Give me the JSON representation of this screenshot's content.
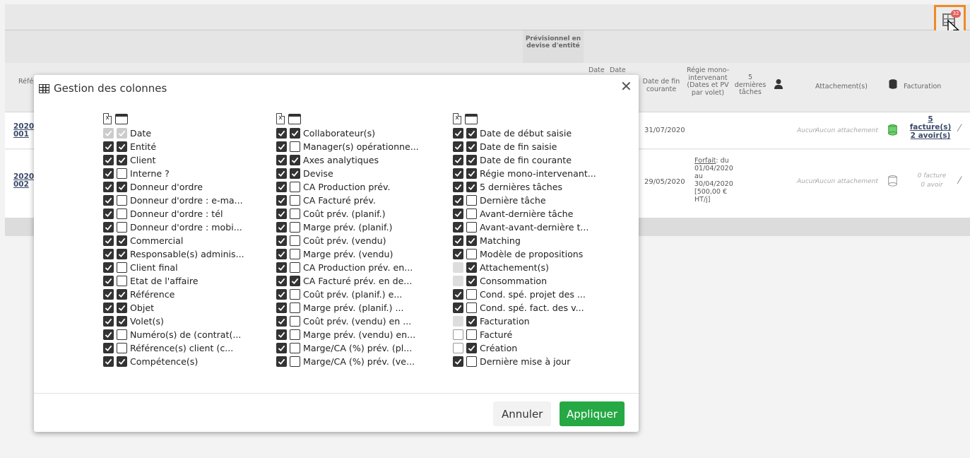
{
  "colors": {
    "accent": "#f08a24",
    "apply": "#26a844",
    "badge": "#e0605a",
    "db_active": "#6fcf6f"
  },
  "toolbar": {
    "columns_badge": "32"
  },
  "table": {
    "group_header": "Prévisionnel en devise d'entité",
    "headers": {
      "ref": "Réfé",
      "date1": "Date",
      "date2": "Date",
      "date_fin": "Date de fin courante",
      "regie": "Régie mono-intervenant (Dates et PV par volet)",
      "dernieres": "5 dernières tâches",
      "attach": "Attachement(s)",
      "facturation": "Facturation"
    },
    "rows": [
      {
        "ref": "2020 001",
        "date_fin": "31/07/2020",
        "regie": "",
        "dernieres": "Aucun",
        "attach": "Aucun attachement",
        "fact_line1": "5",
        "fact_line2": "facture(s)",
        "fact_line3": "2 avoir(s)"
      },
      {
        "ref": "2020 002",
        "date_fin": "29/05/2020",
        "regie_link": "Forfait",
        "regie": ": du 01/04/2020 au 30/04/2020 [500,00 € HT/j]",
        "dernieres": "Aucun",
        "attach": "Aucun attachement",
        "fact_line1": "0 facture",
        "fact_line2": "0 avoir"
      }
    ]
  },
  "modal": {
    "title": "Gestion des colonnes",
    "cancel_label": "Annuler",
    "apply_label": "Appliquer",
    "columns": [
      [
        {
          "label": "Date",
          "excel": "dis",
          "visible": "dis"
        },
        {
          "label": "Entité",
          "excel": "on",
          "visible": "on"
        },
        {
          "label": "Client",
          "excel": "on",
          "visible": "on"
        },
        {
          "label": "Interne ?",
          "excel": "on",
          "visible": "off"
        },
        {
          "label": "Donneur d'ordre",
          "excel": "on",
          "visible": "on"
        },
        {
          "label": "Donneur d'ordre : e-ma...",
          "excel": "on",
          "visible": "off"
        },
        {
          "label": "Donneur d'ordre : tél",
          "excel": "on",
          "visible": "off"
        },
        {
          "label": "Donneur d'ordre : mobi...",
          "excel": "on",
          "visible": "off"
        },
        {
          "label": "Commercial",
          "excel": "on",
          "visible": "on"
        },
        {
          "label": "Responsable(s) adminis...",
          "excel": "on",
          "visible": "on"
        },
        {
          "label": "Client final",
          "excel": "on",
          "visible": "off"
        },
        {
          "label": "Etat de l'affaire",
          "excel": "on",
          "visible": "off"
        },
        {
          "label": "Référence",
          "excel": "on",
          "visible": "on"
        },
        {
          "label": "Objet",
          "excel": "on",
          "visible": "on"
        },
        {
          "label": "Volet(s)",
          "excel": "on",
          "visible": "on"
        },
        {
          "label": "Numéro(s) de (contrat(...",
          "excel": "on",
          "visible": "off"
        },
        {
          "label": "Référence(s) client (c...",
          "excel": "on",
          "visible": "off"
        },
        {
          "label": "Compétence(s)",
          "excel": "on",
          "visible": "on"
        }
      ],
      [
        {
          "label": "Collaborateur(s)",
          "excel": "on",
          "visible": "on"
        },
        {
          "label": "Manager(s) opérationne...",
          "excel": "on",
          "visible": "off"
        },
        {
          "label": "Axes analytiques",
          "excel": "on",
          "visible": "on"
        },
        {
          "label": "Devise",
          "excel": "on",
          "visible": "on"
        },
        {
          "label": "CA Production prév.",
          "excel": "on",
          "visible": "off"
        },
        {
          "label": "CA Facturé prév.",
          "excel": "on",
          "visible": "off"
        },
        {
          "label": "Coût prév. (planif.)",
          "excel": "on",
          "visible": "off"
        },
        {
          "label": "Marge prév. (planif.)",
          "excel": "on",
          "visible": "off"
        },
        {
          "label": "Coût prév. (vendu)",
          "excel": "on",
          "visible": "off"
        },
        {
          "label": "Marge prév. (vendu)",
          "excel": "on",
          "visible": "off"
        },
        {
          "label": "CA Production prév. en...",
          "excel": "on",
          "visible": "off"
        },
        {
          "label": "CA Facturé prév. en de...",
          "excel": "on",
          "visible": "on"
        },
        {
          "label": "Coût prév. (planif.) e...",
          "excel": "on",
          "visible": "off"
        },
        {
          "label": "Marge prév. (planif.) ...",
          "excel": "on",
          "visible": "off"
        },
        {
          "label": "Coût prév. (vendu) en ...",
          "excel": "on",
          "visible": "off"
        },
        {
          "label": "Marge prév. (vendu) en...",
          "excel": "on",
          "visible": "off"
        },
        {
          "label": "Marge/CA (%) prév. (pl...",
          "excel": "on",
          "visible": "off"
        },
        {
          "label": "Marge/CA (%) prév. (ve...",
          "excel": "on",
          "visible": "off"
        }
      ],
      [
        {
          "label": "Date de début saisie",
          "excel": "on",
          "visible": "on"
        },
        {
          "label": "Date de fin saisie",
          "excel": "on",
          "visible": "on"
        },
        {
          "label": "Date de fin courante",
          "excel": "on",
          "visible": "on"
        },
        {
          "label": "Régie mono-intervenant...",
          "excel": "on",
          "visible": "on"
        },
        {
          "label": "5 dernières tâches",
          "excel": "on",
          "visible": "on"
        },
        {
          "label": "Dernière tâche",
          "excel": "on",
          "visible": "off"
        },
        {
          "label": "Avant-dernière tâche",
          "excel": "on",
          "visible": "off"
        },
        {
          "label": "Avant-avant-dernière t...",
          "excel": "on",
          "visible": "off"
        },
        {
          "label": "Matching",
          "excel": "on",
          "visible": "on"
        },
        {
          "label": "Modèle de propositions",
          "excel": "on",
          "visible": "off"
        },
        {
          "label": "Attachement(s)",
          "excel": "blank",
          "visible": "on"
        },
        {
          "label": "Consommation",
          "excel": "blank",
          "visible": "on"
        },
        {
          "label": "Cond. spé. projet des ...",
          "excel": "on",
          "visible": "off"
        },
        {
          "label": "Cond. spé. fact. des v...",
          "excel": "on",
          "visible": "off"
        },
        {
          "label": "Facturation",
          "excel": "blank",
          "visible": "on"
        },
        {
          "label": "Facturé",
          "excel": "doff",
          "visible": "off"
        },
        {
          "label": "Création",
          "excel": "doff",
          "visible": "on"
        },
        {
          "label": "Dernière mise à jour",
          "excel": "on",
          "visible": "off"
        }
      ]
    ]
  }
}
